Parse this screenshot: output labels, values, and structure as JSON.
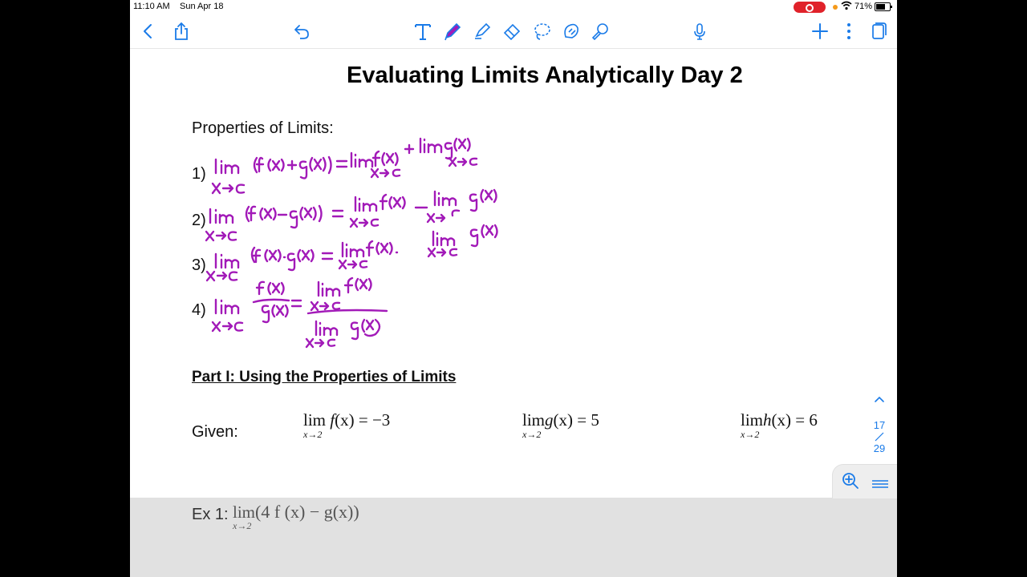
{
  "status": {
    "time": "11:10 AM",
    "date": "Sun Apr 18",
    "battery": "71%"
  },
  "toolbar": {
    "icons": [
      "back-chevron-icon",
      "share-icon",
      "undo-icon",
      "text-tool-icon",
      "pen-icon",
      "highlighter-icon",
      "eraser-icon",
      "lasso-icon",
      "shape-tool-icon",
      "laser-pointer-icon",
      "microphone-icon",
      "add-icon",
      "more-icon",
      "pages-icon"
    ]
  },
  "document": {
    "title": "Evaluating Limits Analytically Day 2",
    "properties_heading": "Properties of Limits:",
    "numbers": [
      "1)",
      "2)",
      "3)",
      "4)"
    ],
    "part_heading": "Part I: Using the Properties of Limits",
    "given_label": "Given:",
    "given": [
      {
        "lim": "lim",
        "sub": "x→2",
        "fn": "f",
        "arg": "(x)",
        "rhs": " = −3"
      },
      {
        "lim": "lim",
        "sub": "x→2",
        "fn": "g",
        "arg": "(x)",
        "rhs": " = 5"
      },
      {
        "lim": "lim",
        "sub": "x→2",
        "fn": "h",
        "arg": "(x)",
        "rhs": " = 6"
      }
    ],
    "ex1_label": "Ex 1:",
    "ex1_lim": "lim",
    "ex1_sub": "x→2",
    "ex1_expr": "(4 f (x) − g(x))",
    "ink_color": "#a21ab8"
  },
  "pagenav": {
    "current": "17",
    "total": "29"
  }
}
